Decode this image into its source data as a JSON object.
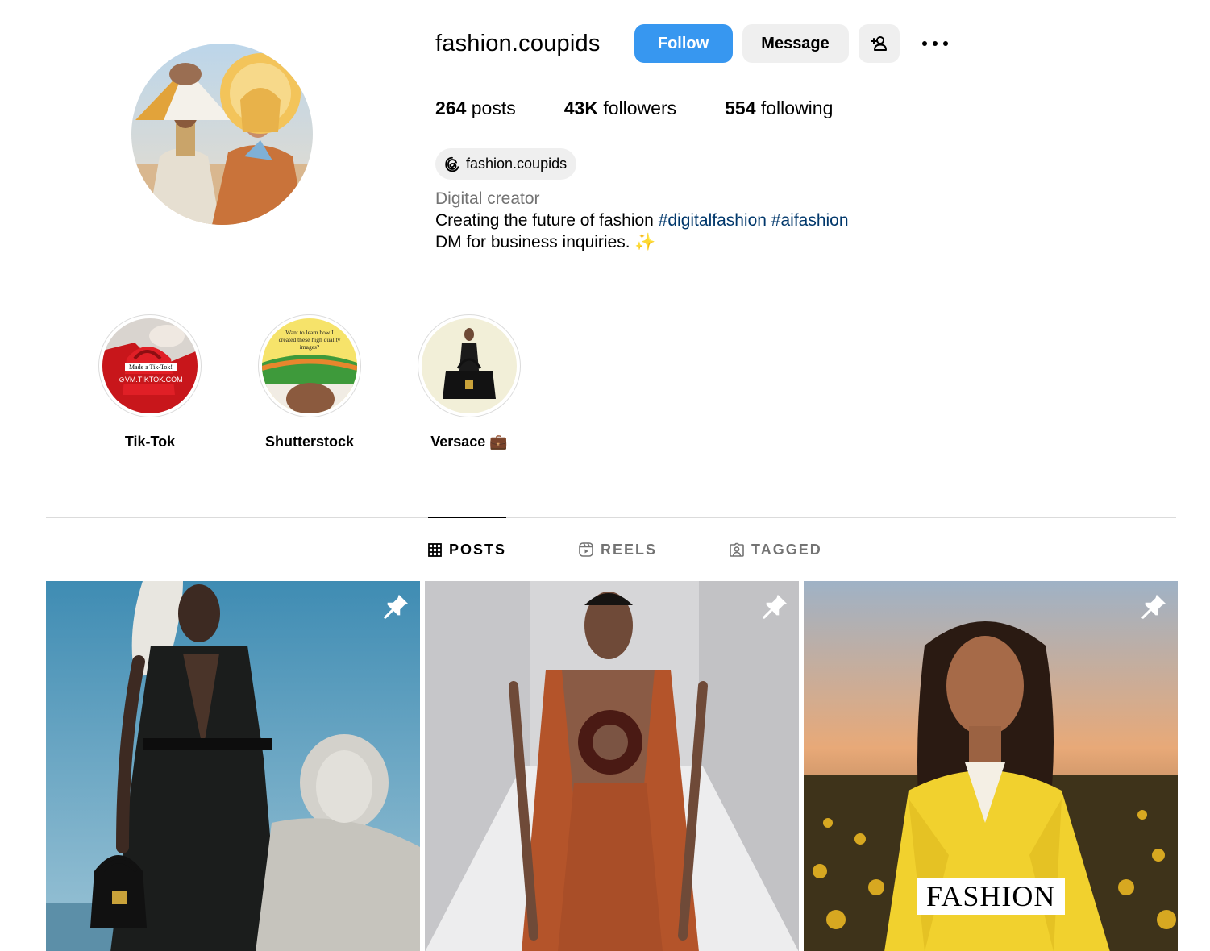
{
  "profile": {
    "username": "fashion.coupids",
    "follow_label": "Follow",
    "message_label": "Message",
    "stats": {
      "posts_count": "264",
      "posts_label": "posts",
      "followers_count": "43K",
      "followers_label": "followers",
      "following_count": "554",
      "following_label": "following"
    },
    "threads_handle": "fashion.coupids",
    "category": "Digital creator",
    "bio_line1_text": "Creating the future of fashion",
    "bio_line1_tag1": "#digitalfashion",
    "bio_line1_tag2": "#aifashion",
    "bio_line2": "DM for business inquiries. ✨"
  },
  "highlights": [
    {
      "label": "Tik-Tok",
      "overlay_top": "Made a Tik-Tok!",
      "overlay_bottom": "⊘VM.TIKTOK.COM"
    },
    {
      "label": "Shutterstock",
      "overlay_top": "Want to learn how I created these high quality images?"
    },
    {
      "label": "Versace 💼"
    }
  ],
  "tabs": [
    {
      "label": "POSTS",
      "icon": "grid-icon",
      "active": true
    },
    {
      "label": "REELS",
      "icon": "reels-icon",
      "active": false
    },
    {
      "label": "TAGGED",
      "icon": "tagged-icon",
      "active": false
    }
  ],
  "posts": [
    {
      "pinned": true
    },
    {
      "pinned": true
    },
    {
      "pinned": true,
      "overlay_text": "FASHION"
    }
  ],
  "colors": {
    "accent": "#3797f0",
    "button_bg": "#efefef",
    "hashtag": "#00376b",
    "muted": "#737373",
    "divider": "#dbdbdb"
  }
}
